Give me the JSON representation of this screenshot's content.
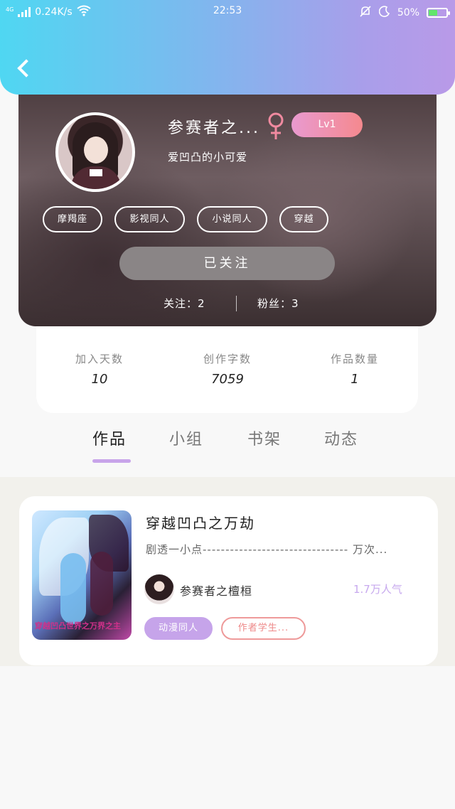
{
  "status_bar": {
    "network": "4G",
    "speed": "0.24K/s",
    "time": "22:53",
    "battery": "50%",
    "battery_level": 0.5,
    "icons": [
      "signal-icon",
      "wifi-icon",
      "mute-icon",
      "moon-icon",
      "battery-icon"
    ]
  },
  "header": {
    "back_icon": "back-arrow-icon",
    "gradient_colors": [
      "#4fd7f2",
      "#b99ae8"
    ]
  },
  "profile": {
    "name": "参赛者之...",
    "gender_icon": "female-icon",
    "level": "Lv1",
    "signature": "爱凹凸的小可爱",
    "tags": [
      "摩羯座",
      "影视同人",
      "小说同人",
      "穿越"
    ],
    "follow_button": "已关注",
    "following": "关注：2",
    "followers": "粉丝：3"
  },
  "stats": [
    {
      "label": "加入天数",
      "value": "10"
    },
    {
      "label": "创作字数",
      "value": "7059"
    },
    {
      "label": "作品数量",
      "value": "1"
    }
  ],
  "tabs": [
    {
      "label": "作品",
      "active": true
    },
    {
      "label": "小组",
      "active": false
    },
    {
      "label": "书架",
      "active": false
    },
    {
      "label": "动态",
      "active": false
    }
  ],
  "works": [
    {
      "cover_text": "穿越凹凸世界之万界之主",
      "title": "穿越凹凸之万劫",
      "description": "剧透一小点-------------------------------- 万次...",
      "author": "参赛者之檀桓",
      "popularity": "1.7万人气",
      "tags": [
        "动漫同人",
        "作者学生..."
      ]
    }
  ],
  "colors": {
    "accent": "#c6a4ea",
    "level_badge": "#f5898e",
    "author_tag_border": "#ee9a9a"
  }
}
